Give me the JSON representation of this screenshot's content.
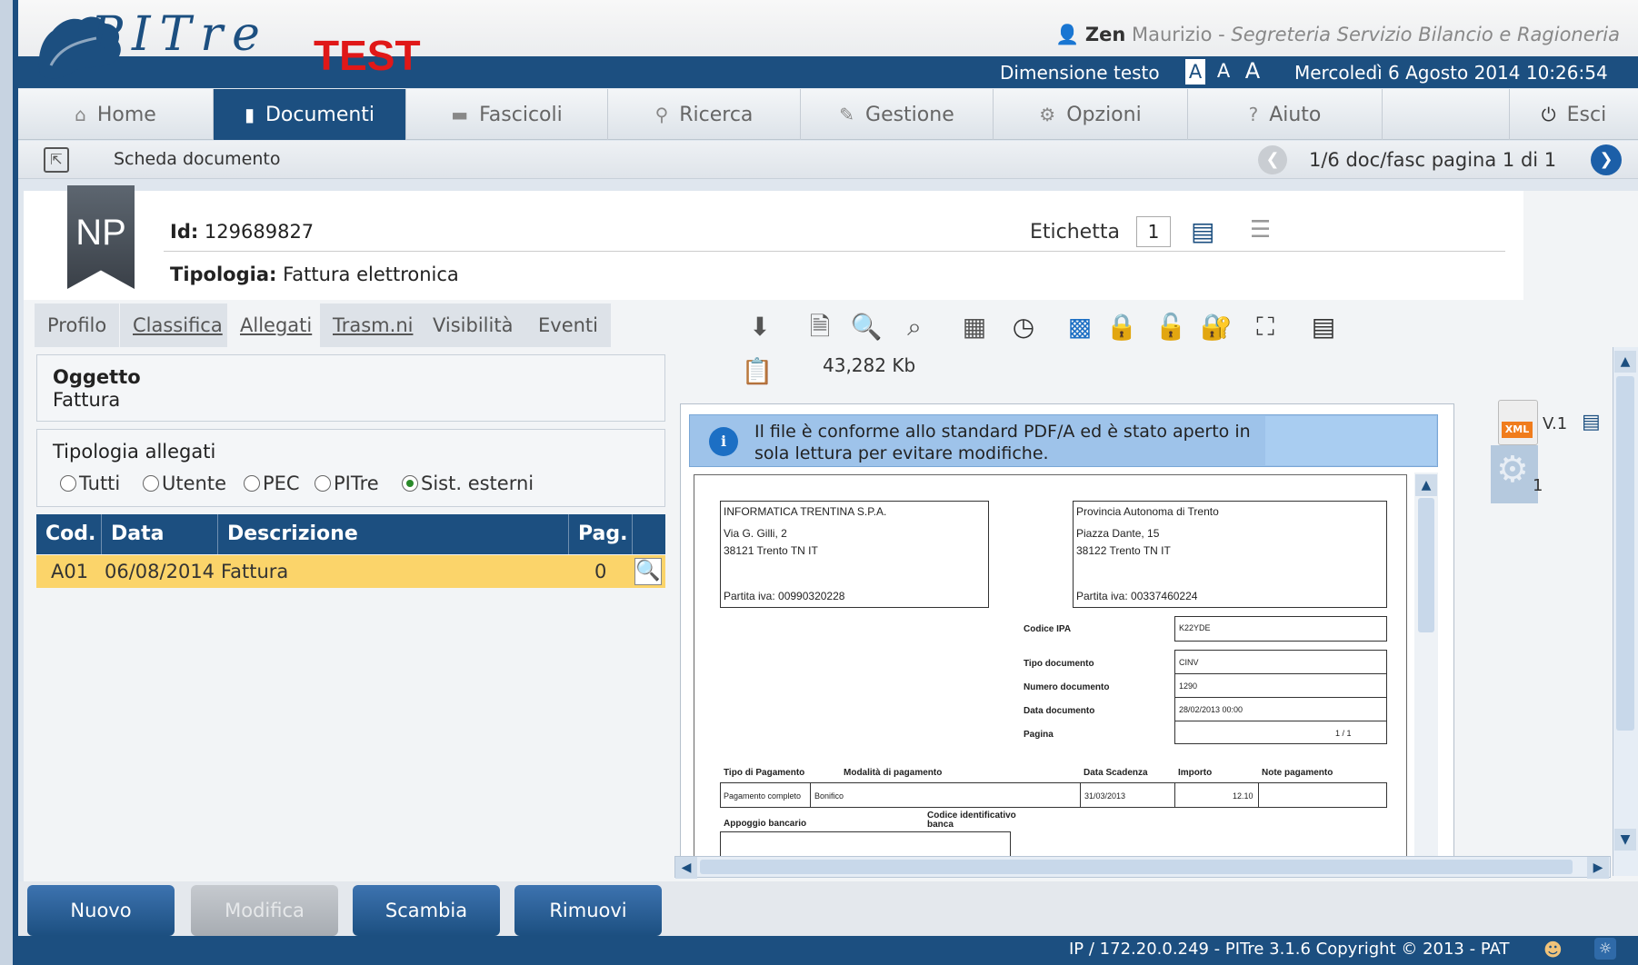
{
  "header": {
    "logo_text": "PITre",
    "logo_test": "TEST",
    "user_surname": "Zen",
    "user_name": " Maurizio - ",
    "user_office": "Segreteria Servizio Bilancio e Ragioneria",
    "text_size_label": "Dimensione testo",
    "text_size_options": [
      "A",
      "A",
      "A"
    ],
    "datetime": "Mercoledì 6 Agosto 2014 10:26:54"
  },
  "nav": {
    "items": [
      {
        "label": "Home",
        "icon": "home-icon"
      },
      {
        "label": "Documenti",
        "icon": "document-icon",
        "active": true
      },
      {
        "label": "Fascicoli",
        "icon": "folder-icon"
      },
      {
        "label": "Ricerca",
        "icon": "search-icon"
      },
      {
        "label": "Gestione",
        "icon": "pencil-icon"
      },
      {
        "label": "Opzioni",
        "icon": "options-icon"
      },
      {
        "label": "Aiuto",
        "icon": "help-icon"
      },
      {
        "label": "Esci",
        "icon": "power-icon"
      }
    ]
  },
  "breadcrumb": {
    "title": "Scheda documento",
    "pager": "1/6 doc/fasc pagina 1 di 1"
  },
  "document": {
    "badge": "NP",
    "id_label": "Id:",
    "id_value": " 129689827",
    "type_label": "Tipologia:",
    "type_value": " Fattura elettronica",
    "label_caption": "Etichetta",
    "label_value": "1"
  },
  "tabs": [
    "Profilo",
    "Classifica",
    "Allegati",
    "Trasm.ni",
    "Visibilità",
    "Eventi"
  ],
  "subject": {
    "title": "Oggetto",
    "value": "Fattura"
  },
  "attachment_types": {
    "title": "Tipologia allegati",
    "options": [
      "Tutti",
      "Utente",
      "PEC",
      "PITre",
      "Sist. esterni"
    ],
    "selected": "Sist. esterni"
  },
  "table": {
    "headers": [
      "Cod.",
      "Data",
      "Descrizione",
      "Pag."
    ],
    "rows": [
      [
        "A01",
        "06/08/2014",
        "Fattura",
        "0"
      ]
    ]
  },
  "viewer": {
    "file_size": "43,282 Kb",
    "info_message": "Il file è conforme allo standard PDF/A ed è stato aperto in sola lettura per evitare modifiche.",
    "version_label": "V.1",
    "version_count": "1",
    "pdf": {
      "sender": [
        "INFORMATICA TRENTINA S.P.A.",
        "Via G. Gilli, 2",
        "38121 Trento TN IT",
        "Partita iva: 00990320228"
      ],
      "recipient": [
        "Provincia Autonoma di Trento",
        "Piazza Dante, 15",
        "38122 Trento TN IT",
        "Partita iva: 00337460224"
      ],
      "fields": [
        {
          "label": "Codice IPA",
          "value": "K22YDE"
        },
        {
          "label": "Tipo documento",
          "value": "CINV"
        },
        {
          "label": "Numero documento",
          "value": "1290"
        },
        {
          "label": "Data documento",
          "value": "28/02/2013 00:00"
        },
        {
          "label": "Pagina",
          "value": "1 / 1"
        }
      ],
      "payment_headers": [
        "Tipo di Pagamento",
        "Modalità di pagamento",
        "Data Scadenza",
        "Importo",
        "Note pagamento"
      ],
      "payment_row": [
        "Pagamento completo",
        "Bonifico",
        "31/03/2013",
        "12.10",
        ""
      ],
      "bank_labels": [
        "Appoggio bancario",
        "Codice identificativo banca"
      ]
    }
  },
  "buttons": {
    "new": "Nuovo",
    "edit": "Modifica",
    "swap": "Scambia",
    "remove": "Rimuovi"
  },
  "footer": {
    "text": "IP / 172.20.0.249 - PITre 3.1.6 Copyright © 2013 - PAT"
  },
  "colors": {
    "primary": "#1c4f80",
    "highlight_row": "#fbd46a",
    "logo_test": "#e01818"
  }
}
